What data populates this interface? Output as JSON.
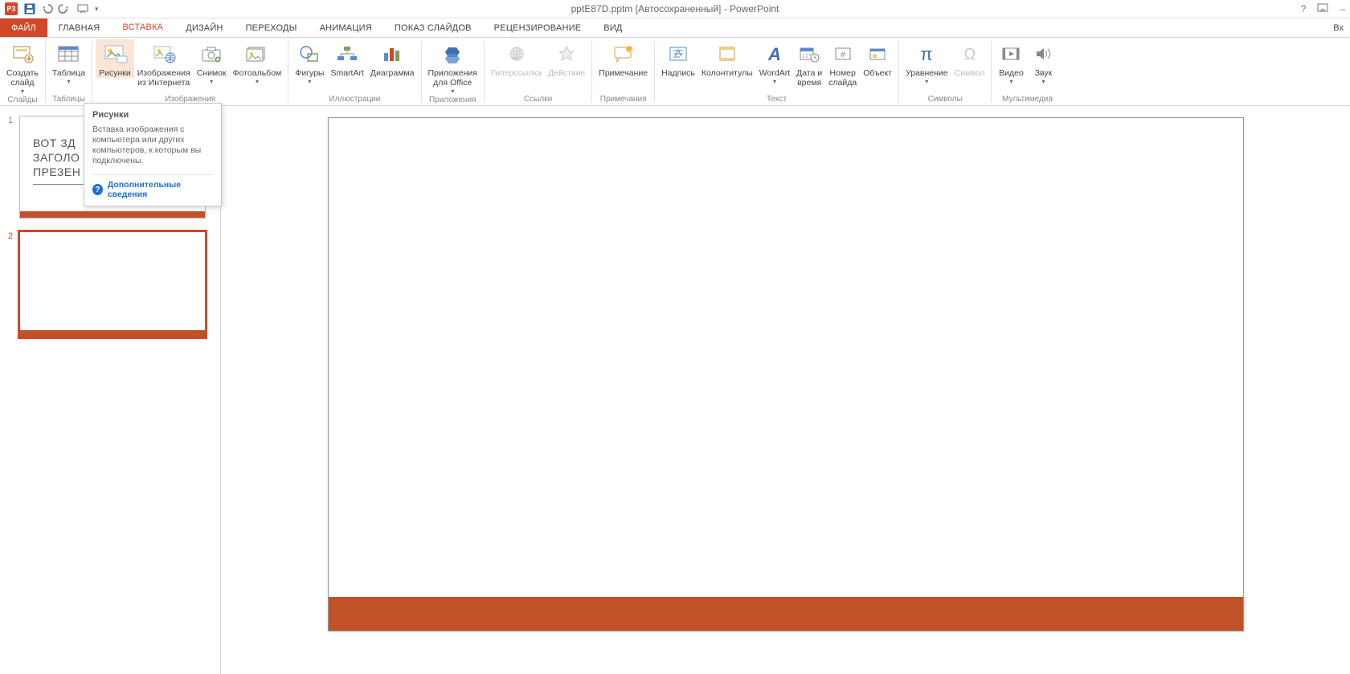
{
  "window_title": "pptE87D.pptm [Автосохраненный] - PowerPoint",
  "qat_ppt": "P3",
  "tabs": {
    "file": "ФАЙЛ",
    "items": [
      "ГЛАВНАЯ",
      "ВСТАВКА",
      "ДИЗАЙН",
      "ПЕРЕХОДЫ",
      "АНИМАЦИЯ",
      "ПОКАЗ СЛАЙДОВ",
      "РЕЦЕНЗИРОВАНИЕ",
      "ВИД"
    ],
    "right": "Вх"
  },
  "ribbon": {
    "groups": {
      "slides": {
        "label": "Слайды",
        "new_slide": "Создать\nслайд"
      },
      "tables": {
        "label": "Таблицы",
        "table": "Таблица"
      },
      "images": {
        "label": "Изображения",
        "pictures": "Рисунки",
        "online": "Изображения\nиз Интернета",
        "screenshot": "Снимок",
        "album": "Фотоальбом"
      },
      "illus": {
        "label": "Иллюстрации",
        "shapes": "Фигуры",
        "smartart": "SmartArt",
        "chart": "Диаграмма"
      },
      "apps": {
        "label": "Приложения",
        "apps": "Приложения\nдля Office"
      },
      "links": {
        "label": "Ссылки",
        "hyperlink": "Гиперссылка",
        "action": "Действие"
      },
      "comments": {
        "label": "Примечания",
        "comment": "Примечание"
      },
      "text": {
        "label": "Текст",
        "textbox": "Надпись",
        "headerfooter": "Колонтитулы",
        "wordart": "WordArt",
        "datetime": "Дата и\nвремя",
        "slidenum": "Номер\nслайда",
        "object": "Объект"
      },
      "symbols": {
        "label": "Символы",
        "equation": "Уравнение",
        "symbol": "Символ"
      },
      "media": {
        "label": "Мультимедиа",
        "video": "Видео",
        "audio": "Звук"
      }
    }
  },
  "tooltip": {
    "title": "Рисунки",
    "body": "Вставка изображения с компьютера или других компьютеров, к которым вы подключены.",
    "link": "Дополнительные сведения"
  },
  "thumbs": {
    "n1": "1",
    "n2": "2",
    "t1_line1": "ВОТ ЗД",
    "t1_line2": "ЗАГОЛО",
    "t1_line3": "ПРЕЗЕН"
  }
}
